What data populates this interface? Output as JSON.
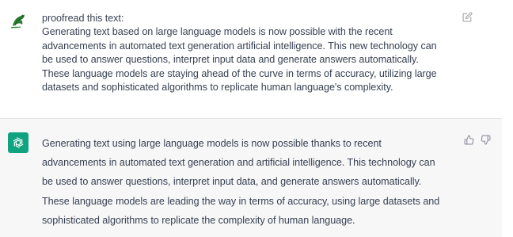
{
  "conversation": {
    "user": {
      "avatar_icon": "user-avatar-icon",
      "lines": [
        "proofread this text:",
        "Generating text based on large language models is now possible with the recent",
        "advancements in automated text generation artificial intelligence. This new technology can",
        "be used to answer questions, interpret input data and generate answers automatically.",
        "These language models are staying ahead of the curve in terms of accuracy, utilizing large",
        "datasets and sophisticated algorithms to replicate human language's complexity."
      ],
      "actions": {
        "edit_icon": "edit-icon"
      }
    },
    "assistant": {
      "avatar_icon": "chatgpt-logo-icon",
      "lines": [
        "Generating text using large language models is now possible thanks to recent",
        "advancements in automated text generation and artificial intelligence. This technology can",
        "be used to answer questions, interpret input data, and generate answers automatically.",
        "These language models are leading the way in terms of accuracy, using large datasets and",
        "sophisticated algorithms to replicate the complexity of human language."
      ],
      "actions": {
        "thumbs_up_icon": "thumbs-up-icon",
        "thumbs_down_icon": "thumbs-down-icon"
      }
    }
  },
  "colors": {
    "text": "#374151",
    "assistant_bg": "#f7f7f8",
    "brand_green": "#10a37f",
    "icon_gray": "#a3a3a8"
  }
}
